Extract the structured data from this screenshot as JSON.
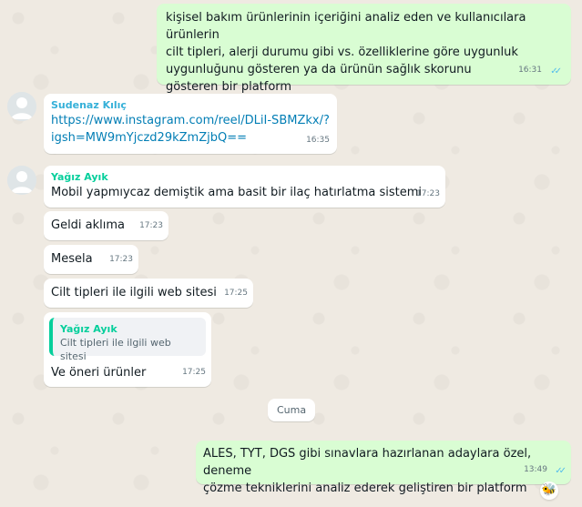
{
  "messages": {
    "m1": {
      "lines": [
        "kişisel bakım ürünlerinin içeriğini analiz eden ve kullanıcılara ürünlerin",
        "cilt tipleri, alerji durumu gibi vs. özelliklerine göre uygunluk",
        "uygunluğunu gösteren ya da ürünün sağlık skorunu",
        "gösteren bir platform"
      ],
      "time": "16:31"
    },
    "m2": {
      "sender": "Sudenaz Kılıç",
      "lines": [
        "https://www.instagram.com/reel/DLiI-SBMZkx/?",
        "igsh=MW9mYjczd29kZmZjbQ=="
      ],
      "time": "16:35"
    },
    "m3": {
      "sender": "Yağız Ayık",
      "text": "Mobil yapmıycaz demiştik ama basit bir ilaç hatırlatma sistemi",
      "time": "17:23"
    },
    "m4": {
      "text": "Geldi aklıma",
      "time": "17:23"
    },
    "m5": {
      "text": "Mesela",
      "time": "17:23"
    },
    "m6": {
      "text": "Cilt tipleri ile ilgili web sitesi",
      "time": "17:25"
    },
    "m7": {
      "quote_sender": "Yağız Ayık",
      "quote_text": "Cilt tipleri ile ilgili web sitesi",
      "text": "Ve öneri ürünler",
      "time": "17:25"
    },
    "date_divider": "Cuma",
    "m8": {
      "lines": [
        "ALES, TYT, DGS gibi sınavlara hazırlanan adaylara özel, deneme",
        "çözme tekniklerini analiz ederek geliştiren bir platform"
      ],
      "time": "13:49",
      "reaction": "🐝"
    }
  },
  "colors": {
    "outgoing_bubble": "#d9fdd3",
    "incoming_bubble": "#ffffff",
    "chat_background": "#efeae2",
    "sender_sudenaz": "#35b0d8",
    "sender_yagiz": "#06cf9c",
    "link": "#027eb5",
    "read_ticks": "#53bdeb"
  },
  "icons": {
    "read_receipt": "double-check-icon",
    "avatar": "default-avatar-icon"
  }
}
